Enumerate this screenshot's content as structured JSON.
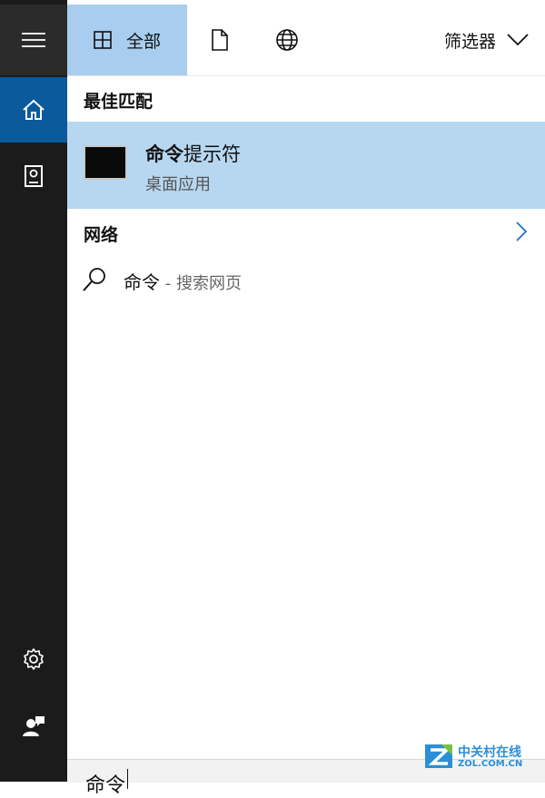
{
  "sidebar": {
    "items": [
      {
        "name": "menu",
        "icon": "hamburger-icon"
      },
      {
        "name": "home",
        "icon": "home-icon"
      },
      {
        "name": "notebook",
        "icon": "notebook-icon"
      },
      {
        "name": "settings",
        "icon": "gear-icon"
      },
      {
        "name": "feedback",
        "icon": "feedback-icon"
      }
    ],
    "accent": "#0b5a9c"
  },
  "header": {
    "tabs": [
      {
        "label": "全部",
        "icon": "grid-icon",
        "selected": true
      },
      {
        "label": "",
        "icon": "document-icon",
        "selected": false
      },
      {
        "label": "",
        "icon": "globe-icon",
        "selected": false
      }
    ],
    "filter_label": "筛选器",
    "tab_highlight": "#a9cdee"
  },
  "results": {
    "best_match": {
      "title": "最佳匹配",
      "item": {
        "name_bold": "命令",
        "name_rest": "提示符",
        "subtitle": "桌面应用",
        "icon": "command-prompt-icon"
      },
      "highlight": "#b7d7f1"
    },
    "web": {
      "title": "网络",
      "query": "命令",
      "suffix": " - 搜索网页"
    }
  },
  "search": {
    "query": "命令"
  },
  "watermark": {
    "brand": "中关村在线",
    "domain": "ZOL.COM.CN"
  }
}
